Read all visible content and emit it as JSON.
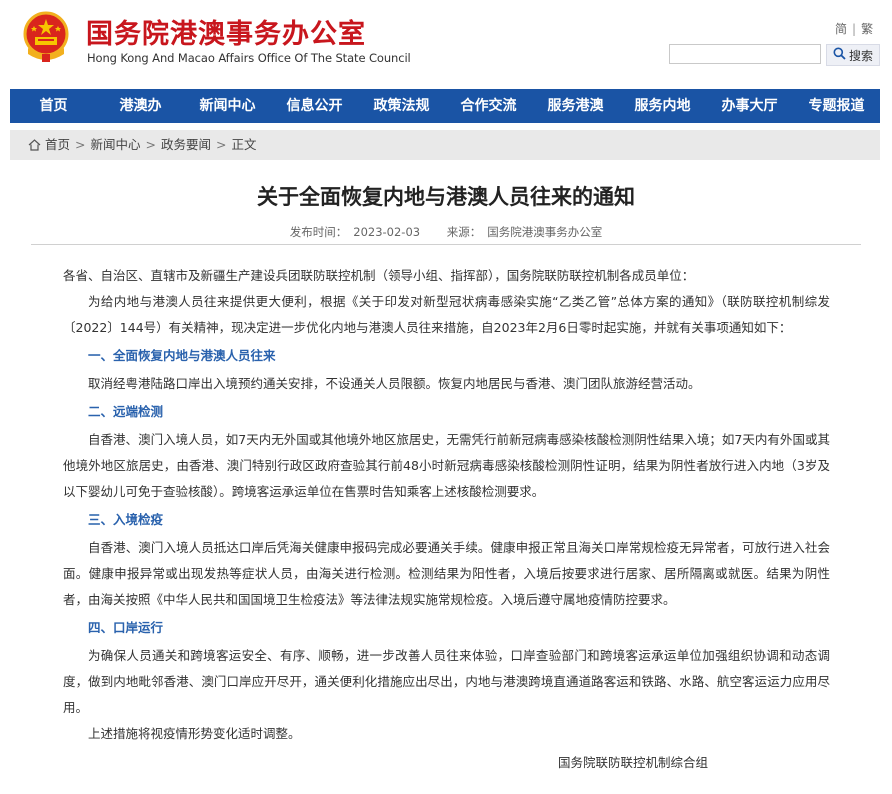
{
  "header": {
    "site_title_cn": "国务院港澳事务办公室",
    "site_title_en": "Hong Kong And Macao Affairs Office Of The State Council",
    "lang_simplified": "简",
    "lang_traditional": "繁",
    "search_placeholder": "",
    "search_button": "搜索"
  },
  "nav": {
    "items": [
      "首页",
      "港澳办",
      "新闻中心",
      "信息公开",
      "政策法规",
      "合作交流",
      "服务港澳",
      "服务内地",
      "办事大厅",
      "专题报道"
    ]
  },
  "breadcrumb": {
    "items": [
      "首页",
      "新闻中心",
      "政务要闻",
      "正文"
    ],
    "separator": ">"
  },
  "article": {
    "title": "关于全面恢复内地与港澳人员往来的通知",
    "publish_label": "发布时间：",
    "publish_date": "2023-02-03",
    "source_label": "来源：",
    "source": "国务院港澳事务办公室",
    "salutation": "各省、自治区、直辖市及新疆生产建设兵团联防联控机制（领导小组、指挥部），国务院联防联控机制各成员单位：",
    "intro": "为给内地与港澳人员往来提供更大便利，根据《关于印发对新型冠状病毒感染实施“乙类乙管”总体方案的通知》（联防联控机制综发〔2022〕144号）有关精神，现决定进一步优化内地与港澳人员往来措施，自2023年2月6日零时起实施，并就有关事项通知如下：",
    "sections": [
      {
        "heading": "一、全面恢复内地与港澳人员往来",
        "body": "取消经粤港陆路口岸出入境预约通关安排，不设通关人员限额。恢复内地居民与香港、澳门团队旅游经营活动。"
      },
      {
        "heading": "二、远端检测",
        "body": "自香港、澳门入境人员，如7天内无外国或其他境外地区旅居史，无需凭行前新冠病毒感染核酸检测阴性结果入境；如7天内有外国或其他境外地区旅居史，由香港、澳门特别行政区政府查验其行前48小时新冠病毒感染核酸检测阴性证明，结果为阴性者放行进入内地（3岁及以下婴幼儿可免于查验核酸）。跨境客运承运单位在售票时告知乘客上述核酸检测要求。"
      },
      {
        "heading": "三、入境检疫",
        "body": "自香港、澳门入境人员抵达口岸后凭海关健康申报码完成必要通关手续。健康申报正常且海关口岸常规检疫无异常者，可放行进入社会面。健康申报异常或出现发热等症状人员，由海关进行检测。检测结果为阳性者，入境后按要求进行居家、居所隔离或就医。结果为阴性者，由海关按照《中华人民共和国国境卫生检疫法》等法律法规实施常规检疫。入境后遵守属地疫情防控要求。"
      },
      {
        "heading": "四、口岸运行",
        "body": "为确保人员通关和跨境客运安全、有序、顺畅，进一步改善人员往来体验，口岸查验部门和跨境客运承运单位加强组织协调和动态调度，做到内地毗邻香港、澳门口岸应开尽开，通关便利化措施应出尽出，内地与港澳跨境直通道路客运和铁路、水路、航空客运运力应用尽用。"
      }
    ],
    "closing": "上述措施将视疫情形势变化适时调整。",
    "signature": "国务院联防联控机制综合组"
  },
  "colors": {
    "brand_red": "#c8161d",
    "nav_blue": "#1a54a5",
    "section_blue": "#2a62ad",
    "breadcrumb_bg": "#e9e9e9"
  }
}
